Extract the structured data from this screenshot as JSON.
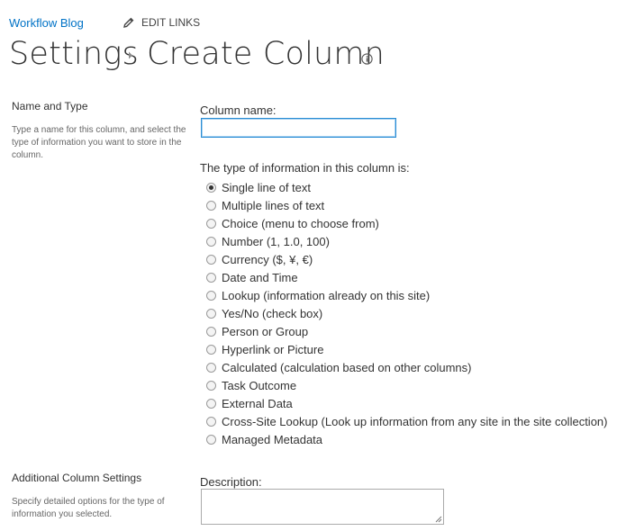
{
  "topbar": {
    "site_link": "Workflow Blog",
    "edit_links": "EDIT LINKS"
  },
  "title": {
    "parent": "Settings",
    "current": "Create Column"
  },
  "sections": {
    "name_type": {
      "title": "Name and Type",
      "description": "Type a name for this column, and select the type of information you want to store in the column."
    },
    "additional": {
      "title": "Additional Column Settings",
      "description": "Specify detailed options for the type of information you selected."
    }
  },
  "form": {
    "column_name_label": "Column name:",
    "column_name_value": "",
    "type_label": "The type of information in this column is:",
    "types": [
      {
        "label": "Single line of text",
        "checked": true
      },
      {
        "label": "Multiple lines of text",
        "checked": false
      },
      {
        "label": "Choice (menu to choose from)",
        "checked": false
      },
      {
        "label": "Number (1, 1.0, 100)",
        "checked": false
      },
      {
        "label": "Currency ($, ¥, €)",
        "checked": false
      },
      {
        "label": "Date and Time",
        "checked": false
      },
      {
        "label": "Lookup (information already on this site)",
        "checked": false
      },
      {
        "label": "Yes/No (check box)",
        "checked": false
      },
      {
        "label": "Person or Group",
        "checked": false
      },
      {
        "label": "Hyperlink or Picture",
        "checked": false
      },
      {
        "label": "Calculated (calculation based on other columns)",
        "checked": false
      },
      {
        "label": "Task Outcome",
        "checked": false
      },
      {
        "label": "External Data",
        "checked": false
      },
      {
        "label": "Cross-Site Lookup (Look up information from any site in the site collection)",
        "checked": false
      },
      {
        "label": "Managed Metadata",
        "checked": false
      }
    ],
    "description_label": "Description:",
    "description_value": ""
  },
  "icons": {
    "edit": "pencil-icon",
    "separator": "breadcrumb-arrow-icon",
    "info": "info-icon"
  },
  "colors": {
    "link": "#0072c6",
    "input_focus_border": "#2a8dd4"
  }
}
